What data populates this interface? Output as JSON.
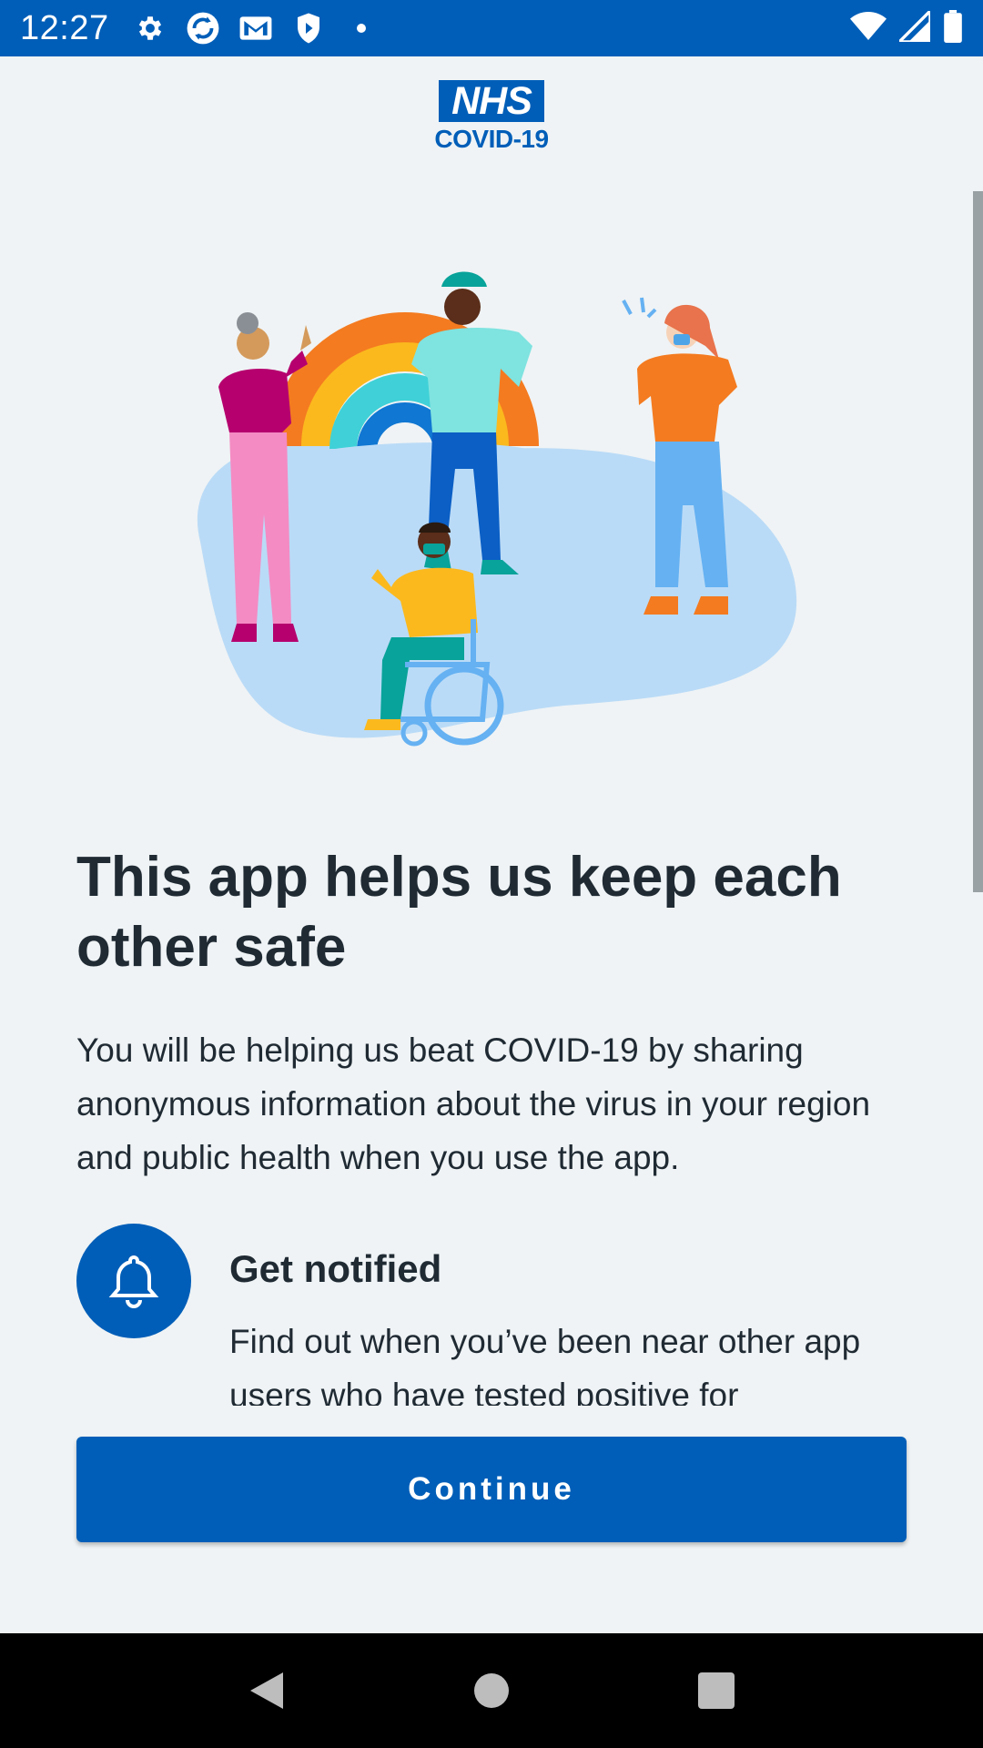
{
  "status_bar": {
    "time": "12:27",
    "icons_left": [
      "settings-icon",
      "sync-icon",
      "gmail-icon",
      "shield-icon",
      "dot-icon"
    ],
    "icons_right": [
      "wifi-icon",
      "signal-icon",
      "battery-icon"
    ]
  },
  "header": {
    "logo_text": "NHS",
    "subtitle": "COVID-19"
  },
  "main": {
    "title": "This app helps us keep each other safe",
    "intro": "You will be helping us beat COVID-19 by sharing anonymous information about the virus in your region and public health when you use the app.",
    "feature": {
      "icon": "bell-icon",
      "title": "Get notified",
      "description": "Find out when you’ve been near other app users who have tested positive for"
    }
  },
  "actions": {
    "continue_label": "Continue"
  },
  "nav_bar": {
    "buttons": [
      "back-icon",
      "home-icon",
      "recents-icon"
    ]
  },
  "colors": {
    "nhs_blue": "#005eb8",
    "background": "#eff3f5",
    "text": "#1f2a33"
  }
}
